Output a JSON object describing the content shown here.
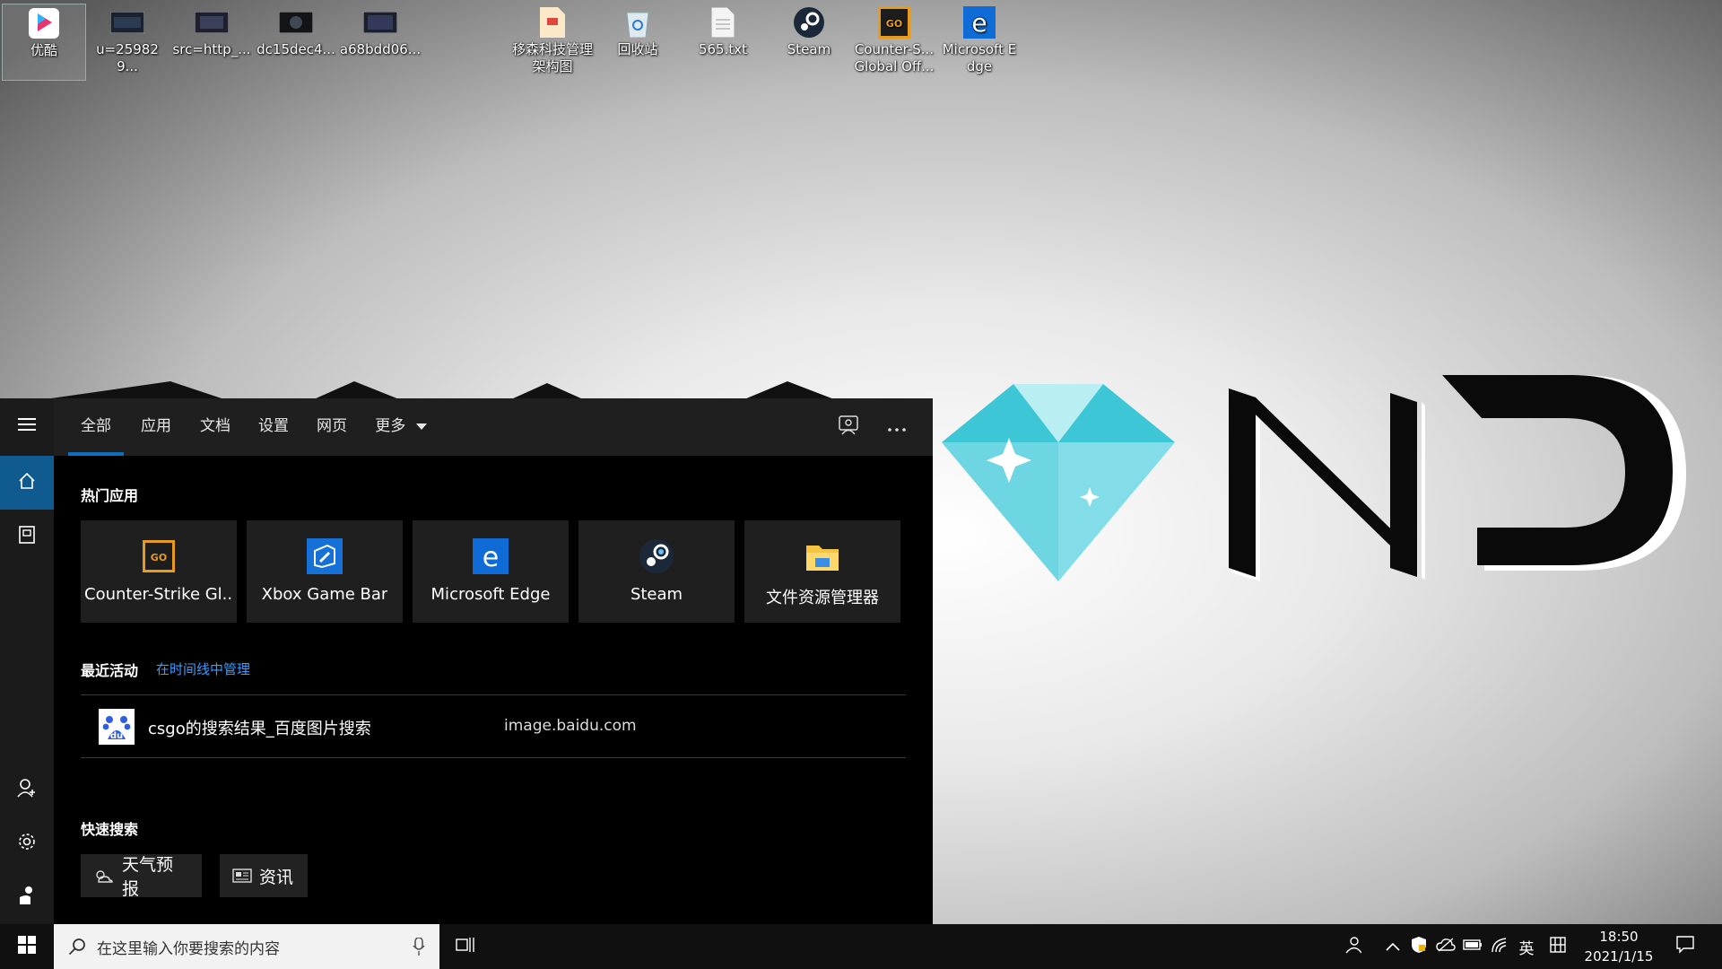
{
  "desktop": {
    "icons": [
      {
        "label": "优酷",
        "icon": "youku-icon"
      },
      {
        "label": "u=259829...",
        "icon": "image-file-icon"
      },
      {
        "label": "src=http_...",
        "icon": "image-file-icon"
      },
      {
        "label": "dc15dec4...",
        "icon": "image-file-icon"
      },
      {
        "label": "a68bdd06...",
        "icon": "image-file-icon"
      },
      {
        "label": "移森科技管理架构图",
        "icon": "document-icon"
      },
      {
        "label": "回收站",
        "icon": "recycle-bin-icon"
      },
      {
        "label": "565.txt",
        "icon": "text-file-icon"
      },
      {
        "label": "Steam",
        "icon": "steam-icon"
      },
      {
        "label": "Counter-S... Global Off...",
        "icon": "csgo-icon"
      },
      {
        "label": "Microsoft Edge",
        "icon": "edge-icon"
      }
    ]
  },
  "search_panel": {
    "tabs": [
      {
        "label": "全部",
        "active": true
      },
      {
        "label": "应用"
      },
      {
        "label": "文档"
      },
      {
        "label": "设置"
      },
      {
        "label": "网页"
      },
      {
        "label": "更多"
      }
    ],
    "top_apps": {
      "title": "热门应用",
      "apps": [
        {
          "label": "Counter-Strike Gl...",
          "icon": "csgo-icon"
        },
        {
          "label": "Xbox Game Bar",
          "icon": "xbox-game-bar-icon"
        },
        {
          "label": "Microsoft Edge",
          "icon": "edge-icon"
        },
        {
          "label": "Steam",
          "icon": "steam-icon"
        },
        {
          "label": "文件资源管理器",
          "icon": "file-explorer-icon"
        }
      ]
    },
    "recent": {
      "title": "最近活动",
      "manage_link": "在时间线中管理",
      "items": [
        {
          "title": "csgo的搜索结果_百度图片搜索",
          "url": "image.baidu.com",
          "icon": "baidu-icon"
        }
      ]
    },
    "quick_search": {
      "title": "快速搜索",
      "buttons": [
        {
          "label": "天气预报",
          "icon": "weather-icon"
        },
        {
          "label": "资讯",
          "icon": "news-icon"
        }
      ]
    }
  },
  "taskbar": {
    "search_placeholder": "在这里输入你要搜索的内容",
    "ime_lang": "英",
    "time": "18:50",
    "date": "2021/1/15"
  },
  "colors": {
    "accent": "#0e6fc0",
    "link": "#3a9cff",
    "diamond": "#4fd0e0"
  }
}
